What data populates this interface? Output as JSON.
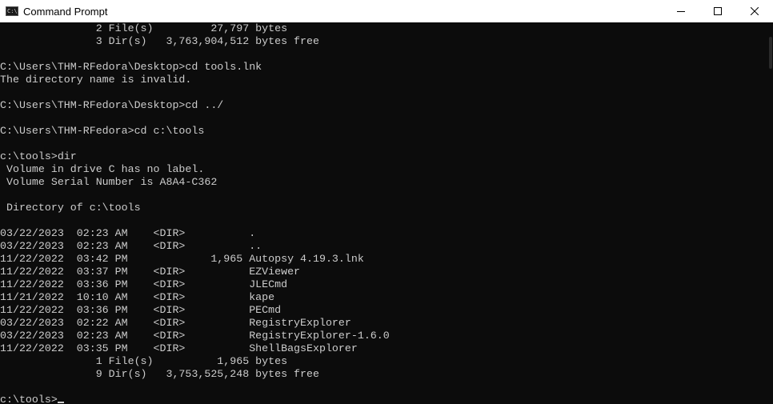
{
  "window": {
    "title": "Command Prompt",
    "icon": "cmd-app-icon"
  },
  "console": {
    "lines": [
      "               2 File(s)         27,797 bytes",
      "               3 Dir(s)   3,763,904,512 bytes free",
      "",
      "C:\\Users\\THM-RFedora\\Desktop>cd tools.lnk",
      "The directory name is invalid.",
      "",
      "C:\\Users\\THM-RFedora\\Desktop>cd ../",
      "",
      "C:\\Users\\THM-RFedora>cd c:\\tools",
      "",
      "c:\\tools>dir",
      " Volume in drive C has no label.",
      " Volume Serial Number is A8A4-C362",
      "",
      " Directory of c:\\tools",
      "",
      "03/22/2023  02:23 AM    <DIR>          .",
      "03/22/2023  02:23 AM    <DIR>          ..",
      "11/22/2022  03:42 PM             1,965 Autopsy 4.19.3.lnk",
      "11/22/2022  03:37 PM    <DIR>          EZViewer",
      "11/22/2022  03:36 PM    <DIR>          JLECmd",
      "11/21/2022  10:10 AM    <DIR>          kape",
      "11/22/2022  03:36 PM    <DIR>          PECmd",
      "03/22/2023  02:22 AM    <DIR>          RegistryExplorer",
      "03/22/2023  02:23 AM    <DIR>          RegistryExplorer-1.6.0",
      "11/22/2022  03:35 PM    <DIR>          ShellBagsExplorer",
      "               1 File(s)          1,965 bytes",
      "               9 Dir(s)   3,753,525,248 bytes free",
      ""
    ],
    "prompt": "c:\\tools>"
  }
}
